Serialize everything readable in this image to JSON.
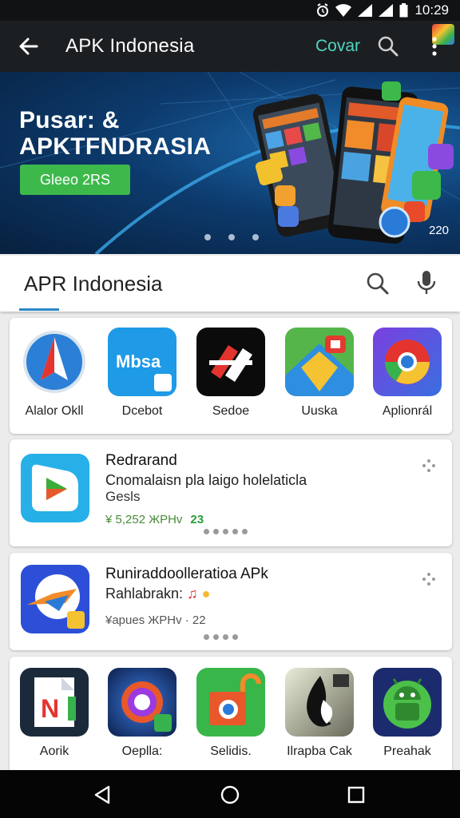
{
  "status_bar": {
    "time": "10:29"
  },
  "app_bar": {
    "title": "APK Indonesia",
    "cover_label": "Covar"
  },
  "banner": {
    "title_line1": "Pusar: &",
    "title_line2": "APKTFNDRASIA",
    "cta_label": "Gleeo 2RS",
    "count": "220"
  },
  "search": {
    "text": "APR Indonesia"
  },
  "top_grid": [
    {
      "label": "Alalor Okll",
      "icon": "compass-arrow-icon"
    },
    {
      "label": "Dcebot",
      "icon": "mbsa-icon"
    },
    {
      "label": "Sedoe",
      "icon": "red-shapes-icon"
    },
    {
      "label": "Uuska",
      "icon": "maps-icon"
    },
    {
      "label": "Aplionrál",
      "icon": "chrome-icon"
    }
  ],
  "list_items": [
    {
      "title": "Redrarand",
      "subtitle": "Cnomalaisn pla laigo holelaticla",
      "subtitle2": "Gesls",
      "meta": "¥ 5,252 ЖPHv",
      "rating": "23"
    },
    {
      "title": "Runiraddoolleratioa APk",
      "subtitle": "Rahlabrakn:",
      "meta": "¥apues ЖPHv · 22",
      "rating": ""
    }
  ],
  "bottom_grid": [
    {
      "label": "Aorik",
      "icon": "document-n-icon"
    },
    {
      "label": "Oeplla:",
      "icon": "galaxy-chrome-icon"
    },
    {
      "label": "Selidis.",
      "icon": "lock-chrome-icon"
    },
    {
      "label": "Ilrapba Cak",
      "icon": "flame-icon"
    },
    {
      "label": "Preahak",
      "icon": "android-icon"
    }
  ],
  "colors": {
    "accent": "#2a88c7",
    "cta": "#3db94b",
    "cover": "#4fd6c0"
  }
}
